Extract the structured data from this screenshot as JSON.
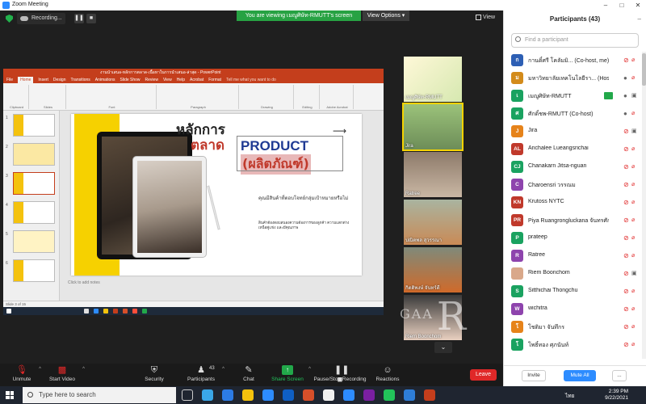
{
  "window": {
    "title": "Zoom Meeting"
  },
  "topbar": {
    "recording_label": "Recording...",
    "viewing_banner": "You are viewing เมญูศิษัท-RMUTT's screen",
    "view_options": "View Options",
    "view_label": "View"
  },
  "ppt": {
    "title": "งานนำเสนอ-หลักการตลาด-เนื้อหาในการนำเสนอ-ล่าสุด - PowerPoint",
    "tabs": [
      "File",
      "Home",
      "Insert",
      "Design",
      "Transitions",
      "Animations",
      "Slide Show",
      "Review",
      "View",
      "Help",
      "Acrobat",
      "Format"
    ],
    "active_tab": "Home",
    "search_hint": "Tell me what you want to do",
    "ribbon_groups": [
      "Clipboard",
      "Slides",
      "Font",
      "Paragraph",
      "Drawing",
      "Editing",
      "Adobe Acrobat"
    ],
    "slide": {
      "heading1": "หลักการ",
      "heading2": "ตลาด",
      "product": "PRODUCT",
      "product_thai": "(ผลิตภัณฑ์)",
      "text1": "คุณมีสินค้าที่ตอบโจทย์กลุ่มเป้าหมายหรือไม่",
      "text2": "สินค้าต้องตอบสนองความต้องการของลูกค้า ความแตกต่างเหนือคู่แข่ง และมีคุณภาพ"
    },
    "notes_placeholder": "Click to add notes",
    "status": "Slide 3 of 15",
    "slide_numbers": [
      "1",
      "2",
      "3",
      "4",
      "5",
      "6"
    ]
  },
  "tiles": [
    {
      "name": "เมญูศิษัท-RMUTT"
    },
    {
      "name": "Jira"
    },
    {
      "name": "Ratree"
    },
    {
      "name": "ปณิตพล สุวรรณา"
    },
    {
      "name": "กิตติพงษ์ จันทร์ดี"
    },
    {
      "name": "Riem Boonchom"
    }
  ],
  "watermark": {
    "small": "GAA",
    "big": "R"
  },
  "toolbar": {
    "unmute": "Unmute",
    "start_video": "Start Video",
    "security": "Security",
    "participants": "Participants",
    "participants_count": "43",
    "chat": "Chat",
    "share_screen": "Share Screen",
    "pause_recording": "Pause/Stop Recording",
    "reactions": "Reactions",
    "leave": "Leave"
  },
  "panel": {
    "title": "Participants (43)",
    "search_placeholder": "Find a participant",
    "invite": "Invite",
    "mute_all": "Mute All",
    "more": "...",
    "participants": [
      {
        "initials": "ก",
        "name": "กานดิ์ศรี โคลัมมิ... (Co-host, me)",
        "color": "#2d5fb4",
        "mic": "muted",
        "cam": "off"
      },
      {
        "initials": "ม",
        "name": "มหาวิทยาลัยเทคโนโลยีรา... (Host)",
        "color": "#d38b1b",
        "mic": "on",
        "cam": "off"
      },
      {
        "initials": "เ",
        "name": "เมญูศิษัท-RMUTT",
        "color": "#1aa260",
        "mic": "on",
        "cam": "on"
      },
      {
        "initials": "ศ",
        "name": "ศักดิ์ชพ-RMUTT (Co-host)",
        "color": "#1aa260",
        "mic": "on",
        "cam": "off"
      },
      {
        "initials": "J",
        "name": "Jira",
        "color": "#e6831a",
        "mic": "muted",
        "cam": "on"
      },
      {
        "initials": "AL",
        "name": "Anchalee Lueangsrichai",
        "color": "#c0392b",
        "mic": "muted",
        "cam": "off"
      },
      {
        "initials": "CJ",
        "name": "Chanakarn Jitsa-nguan",
        "color": "#1aa260",
        "mic": "muted",
        "cam": "off"
      },
      {
        "initials": "C",
        "name": "Charoensri วรรณม",
        "color": "#8e44ad",
        "mic": "muted",
        "cam": "off"
      },
      {
        "initials": "KN",
        "name": "Krutoss NYTC",
        "color": "#c0392b",
        "mic": "muted",
        "cam": "off"
      },
      {
        "initials": "PR",
        "name": "Piya Ruangrongluckana จันทรศักดิ์",
        "color": "#c0392b",
        "mic": "muted",
        "cam": "off"
      },
      {
        "initials": "P",
        "name": "prateep",
        "color": "#1aa260",
        "mic": "muted",
        "cam": "off"
      },
      {
        "initials": "R",
        "name": "Ratree",
        "color": "#8e44ad",
        "mic": "muted",
        "cam": "off"
      },
      {
        "initials": "",
        "name": "Riem Boonchom",
        "color": "#d9a88a",
        "mic": "muted",
        "cam": "on"
      },
      {
        "initials": "S",
        "name": "Sitthichai Thongchu",
        "color": "#1aa260",
        "mic": "muted",
        "cam": "off"
      },
      {
        "initials": "W",
        "name": "wichitra",
        "color": "#8e44ad",
        "mic": "muted",
        "cam": "off"
      },
      {
        "initials": "โ",
        "name": "โชติมา จันทึกร",
        "color": "#e6831a",
        "mic": "muted",
        "cam": "off"
      },
      {
        "initials": "โ",
        "name": "โพธิ์ทอง ศุภนันท์",
        "color": "#1aa260",
        "mic": "muted",
        "cam": "off"
      }
    ]
  },
  "taskbar": {
    "search_placeholder": "Type here to search",
    "time": "2:39 PM",
    "date": "9/22/2021",
    "lang": "ไทย"
  }
}
